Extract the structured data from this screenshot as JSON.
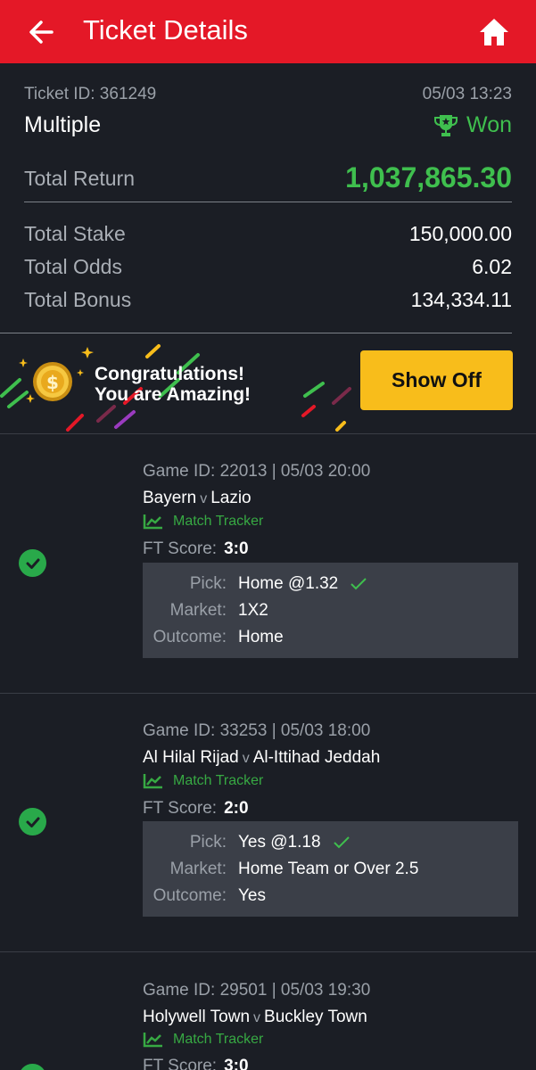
{
  "header": {
    "title": "Ticket Details",
    "back_icon": "arrow-left-icon",
    "home_icon": "home-icon",
    "bg_color": "#e41827"
  },
  "ticket": {
    "id_text": "Ticket ID: 361249",
    "datetime": "05/03 13:23",
    "type": "Multiple",
    "status": "Won",
    "status_color": "#3fbf4e",
    "total_return_label": "Total Return",
    "total_return": "1,037,865.30",
    "total_stake_label": "Total Stake",
    "total_stake": "150,000.00",
    "total_odds_label": "Total Odds",
    "total_odds": "6.02",
    "total_bonus_label": "Total Bonus",
    "total_bonus": "134,334.11"
  },
  "banner": {
    "line1": "Congratulations!",
    "line2": "You are Amazing!",
    "button": "Show Off",
    "button_color": "#f8bd1b"
  },
  "labels": {
    "ft_score": "FT Score:",
    "pick": "Pick:",
    "market": "Market:",
    "outcome": "Outcome:",
    "match_tracker": "Match Tracker",
    "versus": "v"
  },
  "games": [
    {
      "id_line": "Game ID: 22013 | 05/03 20:00",
      "home": "Bayern",
      "away": "Lazio",
      "ft_score": "3:0",
      "pick": "Home @1.32",
      "market": "1X2",
      "outcome": "Home"
    },
    {
      "id_line": "Game ID: 33253 | 05/03 18:00",
      "home": "Al Hilal Rijad",
      "away": "Al-Ittihad Jeddah",
      "ft_score": "2:0",
      "pick": "Yes @1.18",
      "market": "Home Team or Over 2.5",
      "outcome": "Yes"
    },
    {
      "id_line": "Game ID: 29501 | 05/03 19:30",
      "home": "Holywell Town",
      "away": "Buckley Town",
      "ft_score": "3:0"
    }
  ]
}
